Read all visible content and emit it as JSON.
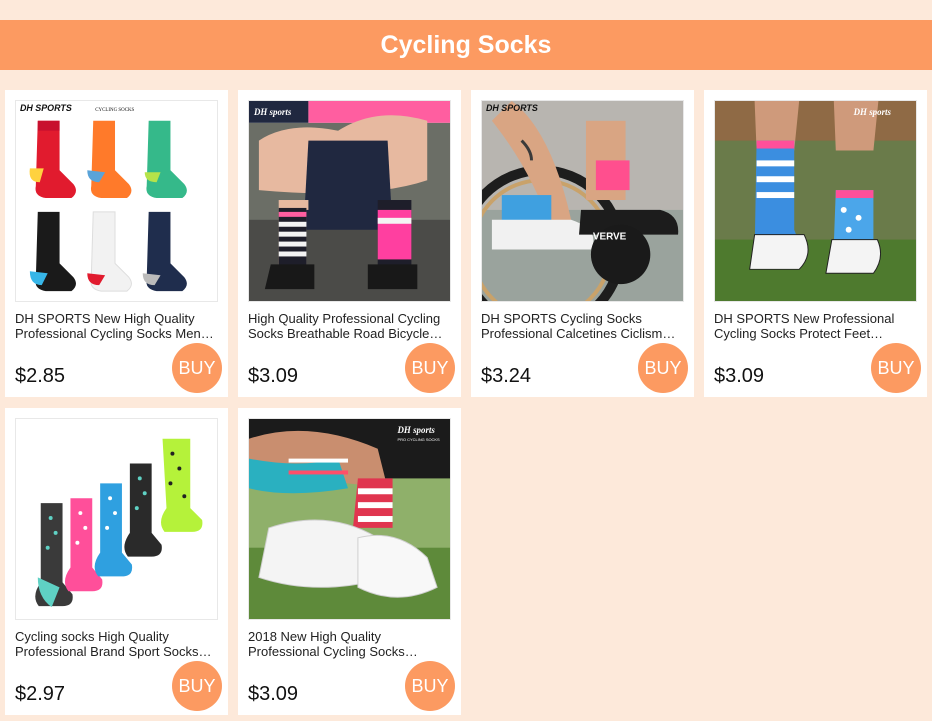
{
  "header": {
    "title": "Cycling Socks"
  },
  "products": [
    {
      "title_line1": "DH SPORTS New High Quality",
      "title_line2": "Professional Cycling Socks Men…",
      "price": "$2.85",
      "buy_label": "BUY",
      "image_brand_text": "DH SPORTS",
      "image_sub_text": "CYCLING SOCKS"
    },
    {
      "title_line1": "High Quality Professional Cycling",
      "title_line2": "Socks Breathable Road Bicycle…",
      "price": "$3.09",
      "buy_label": "BUY",
      "image_brand_text": "DH sports"
    },
    {
      "title_line1": "DH SPORTS Cycling Socks",
      "title_line2": "Professional Calcetines Ciclism…",
      "price": "$3.24",
      "buy_label": "BUY",
      "image_brand_text": "DH SPORTS",
      "image_bike_text": "VERVE"
    },
    {
      "title_line1": "DH SPORTS New Professional",
      "title_line2": "Cycling Socks Protect Feet…",
      "price": "$3.09",
      "buy_label": "BUY",
      "image_brand_text": "DH sports"
    },
    {
      "title_line1": "Cycling socks High Quality",
      "title_line2": "Professional Brand Sport Socks…",
      "price": "$2.97",
      "buy_label": "BUY"
    },
    {
      "title_line1": "2018 New High Quality",
      "title_line2": "Professional Cycling Socks…",
      "price": "$3.09",
      "buy_label": "BUY",
      "image_brand_text": "DH sports",
      "image_sub_text": "PRO CYCLING SOCKS"
    }
  ]
}
